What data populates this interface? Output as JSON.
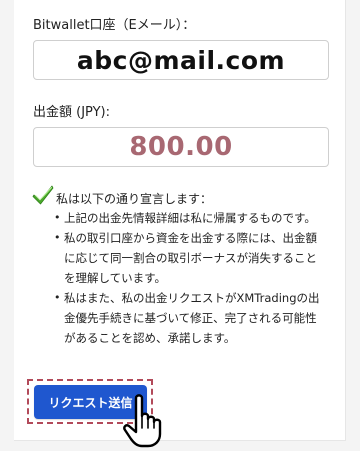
{
  "wallet": {
    "label": "Bitwallet口座（Eメール）：",
    "value": "abc@mail.com"
  },
  "amount": {
    "label": "出金額 (JPY):",
    "value": "800.00"
  },
  "declaration": {
    "title": "私は以下の通り宣言します：",
    "items": [
      "上記の出金先情報詳細は私に帰属するものです。",
      "私の取引口座から資金を出金する際には、出金額に応じて同一割合の取引ボーナスが消失することを理解しています。",
      "私はまた、私の出金リクエストがXMTradingの出金優先手続きに基づいて修正、完了される可能性があることを認め、承諾します。"
    ]
  },
  "submit": {
    "label": "リクエスト送信"
  },
  "colors": {
    "accent": "#1f57cf",
    "amount_text": "#a86872",
    "check": "#4caf2a",
    "highlight_frame": "#b24a5a"
  },
  "icons": {
    "check": "checkmark-icon",
    "cursor": "hand-pointer-icon"
  }
}
